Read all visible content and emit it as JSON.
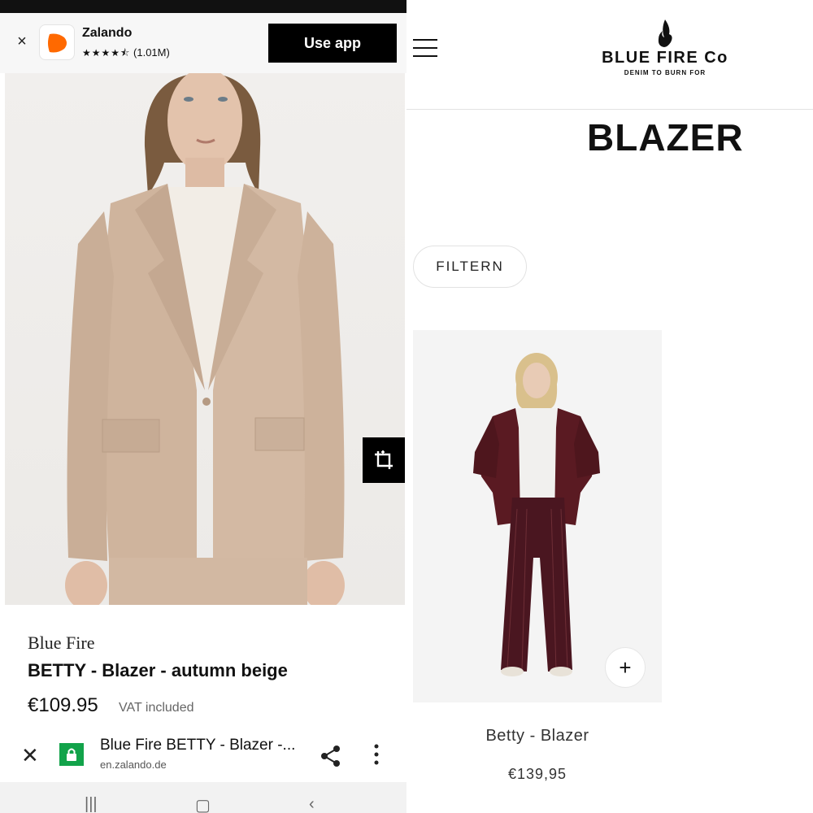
{
  "zalando": {
    "app_banner": {
      "app_name": "Zalando",
      "stars": "★★★★⯪",
      "rating_count": "(1.01M)",
      "use_app_label": "Use app",
      "close_icon": "close-icon"
    },
    "product": {
      "brand": "Blue Fire",
      "title": "BETTY - Blazer - autumn beige",
      "price": "€109.95",
      "vat_note": "VAT included"
    },
    "browser_bar": {
      "page_title": "Blue Fire BETTY - Blazer -...",
      "url": "en.zalando.de",
      "icons": [
        "close-icon",
        "lock-icon",
        "share-icon",
        "more-vert-icon"
      ]
    },
    "colors": {
      "accent": "#ff6900",
      "lock_green": "#12a34a"
    }
  },
  "bluefire": {
    "logo": {
      "name": "BLUE FIRE Co",
      "tagline": "DENIM TO BURN FOR"
    },
    "page_title": "BLAZER",
    "filter_label": "FILTERN",
    "product_card": {
      "name": "Betty - Blazer",
      "price": "€139,95",
      "add_label": "+"
    },
    "colors": {
      "blazer_burgundy": "#5a1a22"
    }
  }
}
